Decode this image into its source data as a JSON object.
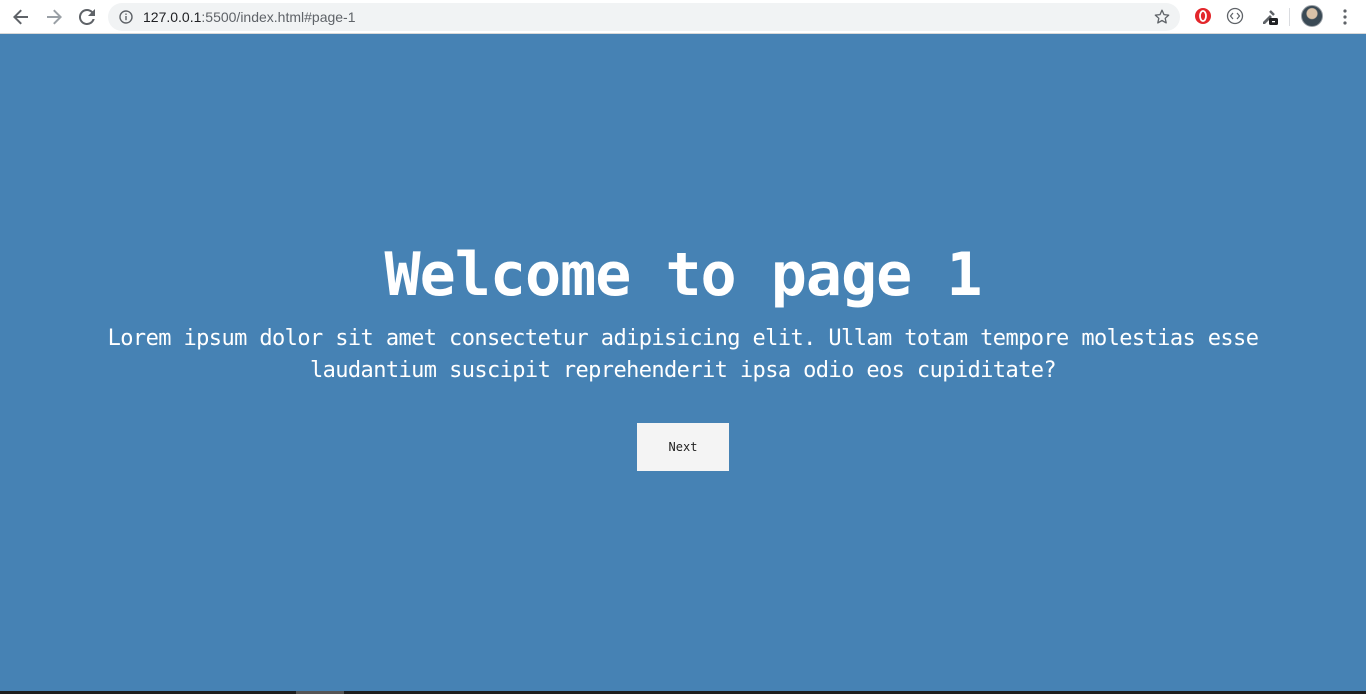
{
  "browser": {
    "url_host": "127.0.0.1",
    "url_rest": ":5500/index.html#page-1"
  },
  "page": {
    "title": "Welcome to page 1",
    "lead": "Lorem ipsum dolor sit amet consectetur adipisicing elit. Ullam totam tempore molestias esse laudantium suscipit reprehenderit ipsa odio eos cupiditate?",
    "next_label": "Next"
  },
  "colors": {
    "background": "#4682b4",
    "button": "#f4f4f4"
  },
  "icons": [
    "back-icon",
    "forward-icon",
    "reload-icon",
    "info-icon",
    "star-icon",
    "opera-extension-icon",
    "code-extension-icon",
    "eyedropper-extension-icon",
    "avatar",
    "menu-icon"
  ]
}
